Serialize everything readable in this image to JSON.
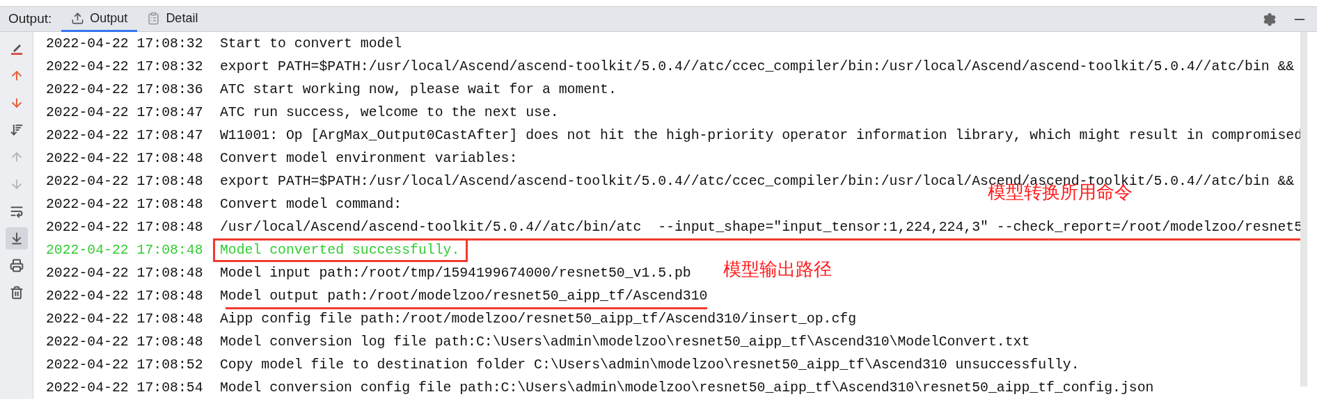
{
  "panel": {
    "label": "Output:",
    "tabs": [
      {
        "label": "Output",
        "selected": true
      },
      {
        "label": "Detail",
        "selected": false
      }
    ]
  },
  "toolbar": [
    {
      "kind": "clear",
      "disabled": false,
      "on": false
    },
    {
      "kind": "up",
      "disabled": false,
      "on": false
    },
    {
      "kind": "down",
      "disabled": false,
      "on": false
    },
    {
      "kind": "sort",
      "disabled": false,
      "on": false
    },
    {
      "kind": "up",
      "disabled": true,
      "on": false
    },
    {
      "kind": "down",
      "disabled": true,
      "on": false
    },
    {
      "kind": "wrap",
      "disabled": false,
      "on": false
    },
    {
      "kind": "scroll",
      "disabled": false,
      "on": true
    },
    {
      "kind": "print",
      "disabled": false,
      "on": false
    },
    {
      "kind": "trash",
      "disabled": false,
      "on": false
    }
  ],
  "log": [
    {
      "time": "2022-04-22 17:08:32",
      "message": "Start to convert model",
      "kind": "info"
    },
    {
      "time": "2022-04-22 17:08:32",
      "message": "export PATH=$PATH:/usr/local/Ascend/ascend-toolkit/5.0.4//atc/ccec_compiler/bin:/usr/local/Ascend/ascend-toolkit/5.0.4//atc/bin &&",
      "kind": "info"
    },
    {
      "time": "2022-04-22 17:08:36",
      "message": "ATC start working now, please wait for a moment.",
      "kind": "info"
    },
    {
      "time": "2022-04-22 17:08:47",
      "message": "ATC run success, welcome to the next use.",
      "kind": "info"
    },
    {
      "time": "2022-04-22 17:08:47",
      "message": "W11001: Op [ArgMax_Output0CastAfter] does not hit the high-priority operator information library, which might result in compromised",
      "kind": "info"
    },
    {
      "time": "2022-04-22 17:08:48",
      "message": "Convert model environment variables:",
      "kind": "info"
    },
    {
      "time": "2022-04-22 17:08:48",
      "message": "export PATH=$PATH:/usr/local/Ascend/ascend-toolkit/5.0.4//atc/ccec_compiler/bin:/usr/local/Ascend/ascend-toolkit/5.0.4//atc/bin &&",
      "kind": "info"
    },
    {
      "time": "2022-04-22 17:08:48",
      "message": "Convert model command:",
      "kind": "info"
    },
    {
      "time": "2022-04-22 17:08:48",
      "message": "/usr/local/Ascend/ascend-toolkit/5.0.4//atc/bin/atc  --input_shape=\"input_tensor:1,224,224,3\" --check_report=/root/modelzoo/resnet5",
      "kind": "info",
      "annotation": {
        "kind": "underline",
        "note": "模型转换所用命令"
      }
    },
    {
      "time": "2022-04-22 17:08:48",
      "message": "Model converted successfully.",
      "kind": "success",
      "annotation": {
        "kind": "box"
      }
    },
    {
      "time": "2022-04-22 17:08:48",
      "message": "Model input path:/root/tmp/1594199674000/resnet50_v1.5.pb",
      "kind": "info"
    },
    {
      "time": "2022-04-22 17:08:48",
      "message": "Model output path:/root/modelzoo/resnet50_aipp_tf/Ascend310",
      "kind": "info",
      "annotation": {
        "kind": "underline",
        "note": "模型输出路径"
      }
    },
    {
      "time": "2022-04-22 17:08:48",
      "message": "Aipp config file path:/root/modelzoo/resnet50_aipp_tf/Ascend310/insert_op.cfg",
      "kind": "info"
    },
    {
      "time": "2022-04-22 17:08:48",
      "message": "Model conversion log file path:C:\\Users\\admin\\modelzoo\\resnet50_aipp_tf\\Ascend310\\ModelConvert.txt",
      "kind": "info"
    },
    {
      "time": "2022-04-22 17:08:52",
      "message": "Copy model file to destination folder C:\\Users\\admin\\modelzoo\\resnet50_aipp_tf\\Ascend310 unsuccessfully.",
      "kind": "info"
    },
    {
      "time": "2022-04-22 17:08:54",
      "message": "Model conversion config file path:C:\\Users\\admin\\modelzoo\\resnet50_aipp_tf\\Ascend310\\resnet50_aipp_tf_config.json",
      "kind": "info"
    }
  ]
}
